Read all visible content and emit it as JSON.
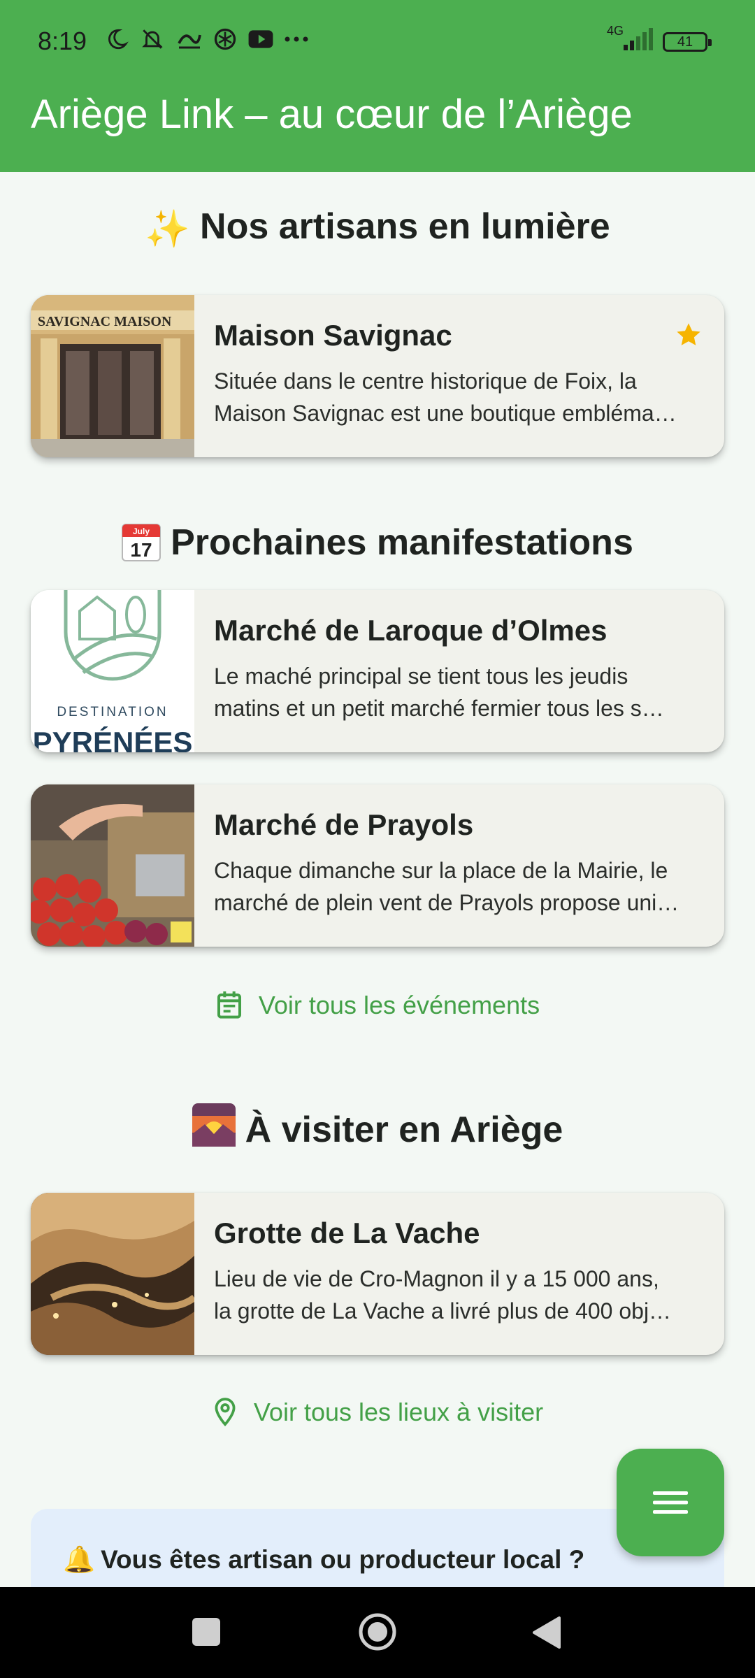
{
  "status_bar": {
    "time": "8:19",
    "network": "4G",
    "battery": "41"
  },
  "app_bar": {
    "title": "Ariège Link – au cœur de l’Ariège"
  },
  "sections": {
    "artisans": {
      "emoji": "✨",
      "title": "Nos artisans en lumière",
      "cards": [
        {
          "title": "Maison Savignac",
          "desc_line1": "Située dans le centre historique de Foix, la",
          "desc_line2": "Maison Savignac est une boutique embléma…",
          "thumb_sign": "SAVIGNAC MAISON",
          "favorite_icon": "star-icon"
        }
      ]
    },
    "events": {
      "emoji_month": "July",
      "emoji_day": "17",
      "title": "Prochaines manifestations",
      "cards": [
        {
          "title": "Marché de Laroque d’Olmes",
          "desc_line1": "Le maché principal se tient tous les jeudis",
          "desc_line2": "matins et un petit marché fermier tous les s…",
          "thumb_text1": "DESTINATION",
          "thumb_text2": "PYRÉNÉES"
        },
        {
          "title": "Marché de Prayols",
          "desc_line1": "Chaque dimanche sur la place de la Mairie, le",
          "desc_line2": "marché de plein vent de Prayols propose uni…"
        }
      ],
      "link_label": "Voir tous les événements"
    },
    "places": {
      "emoji": "🌄",
      "title": "À visiter en Ariège",
      "cards": [
        {
          "title": "Grotte de La Vache",
          "desc_line1": "Lieu de vie de Cro-Magnon il y a 15 000 ans,",
          "desc_line2": "la grotte de La Vache a livré plus de 400 obj…"
        }
      ],
      "link_label": "Voir tous les lieux à visiter"
    }
  },
  "banner": {
    "emoji": "🔔",
    "text": "Vous êtes artisan ou producteur local ?"
  },
  "fab": {
    "icon": "menu-icon"
  },
  "colors": {
    "primary": "#4caf50",
    "link": "#43a047",
    "star": "#f6b400",
    "card_bg": "#f1f2ec",
    "page_bg": "#f3f8f4",
    "banner_bg": "#e3eefb"
  }
}
